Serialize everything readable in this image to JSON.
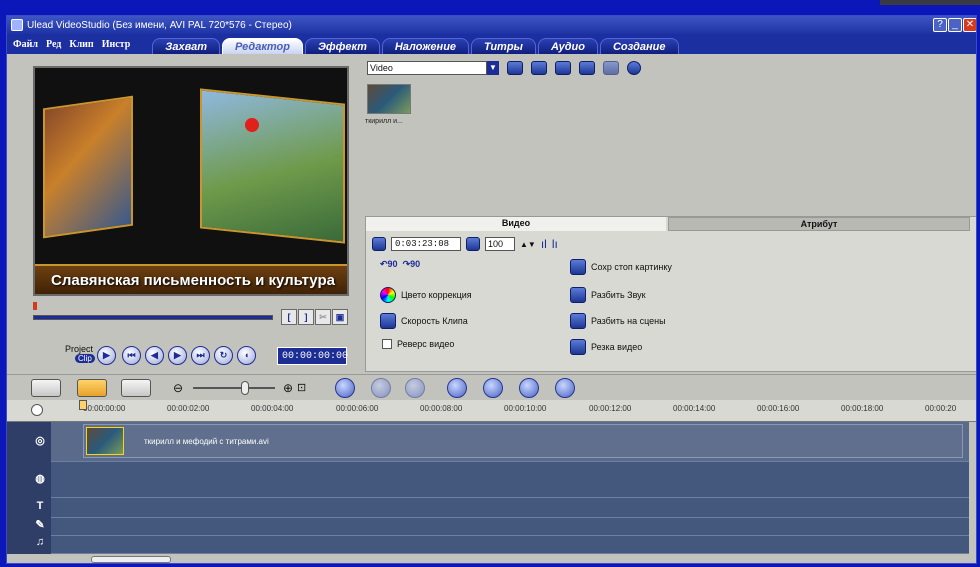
{
  "window": {
    "title": "Ulead VideoStudio (Без имени, AVI PAL 720*576 - Стерео)"
  },
  "menu": {
    "items": [
      "Файл",
      "Ред",
      "Клип",
      "Инстр"
    ]
  },
  "steps": [
    "Захват",
    "Редактор",
    "Эффект",
    "Наложение",
    "Титры",
    "Аудио",
    "Создание"
  ],
  "preview": {
    "banner_text": "Славянская письменность и культура",
    "project_label": "Project",
    "clip_label": "Clip",
    "timecode": "00:00:00:00"
  },
  "library": {
    "category": "Video",
    "thumb_label": "ткирилл и..."
  },
  "options": {
    "tab_video": "Видео",
    "tab_attribute": "Атрибут",
    "duration": "0:03:23:08",
    "volume": "100",
    "color_correction": "Цвето коррекция",
    "clip_speed": "Скорость Клипа",
    "reverse_video": "Реверс видео",
    "save_frame": "Сохр стоп картинку",
    "split_audio": "Разбить Звук",
    "split_scenes": "Разбить на сцены",
    "trim_video": "Резка видео"
  },
  "ruler": [
    "00:00:00:00",
    "00:00:02:00",
    "00:00:04:00",
    "00:00:06:00",
    "00:00:08:00",
    "00:00:10:00",
    "00:00:12:00",
    "00:00:14:00",
    "00:00:16:00",
    "00:00:18:00",
    "00:00:20"
  ],
  "timeline": {
    "clip_name": "ткирилл и мефодий с титрами.avi"
  }
}
